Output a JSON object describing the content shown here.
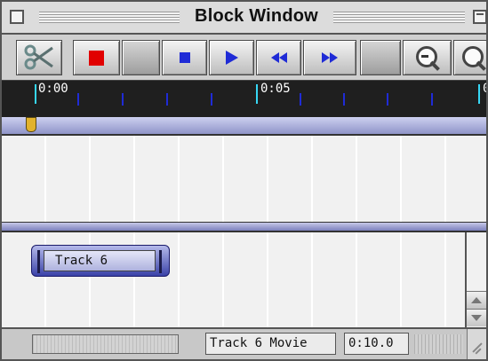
{
  "window": {
    "title": "Block Window"
  },
  "toolbar": {
    "buttons": [
      {
        "name": "cut-button",
        "icon": "scissors-icon"
      },
      {
        "name": "stop-record-button",
        "icon": "red-square-icon"
      },
      {
        "name": "blank-button"
      },
      {
        "name": "stop-button",
        "icon": "stop-icon"
      },
      {
        "name": "play-button",
        "icon": "play-icon"
      },
      {
        "name": "rewind-button",
        "icon": "rewind-icon"
      },
      {
        "name": "fast-forward-button",
        "icon": "fast-forward-icon"
      },
      {
        "name": "blank-button-2"
      },
      {
        "name": "zoom-out-button",
        "icon": "zoom-out-icon"
      },
      {
        "name": "zoom-in-button",
        "icon": "zoom-in-icon"
      }
    ]
  },
  "ruler": {
    "label_start": "0:00",
    "label_mid": "0:05",
    "label_end": "0"
  },
  "timeline": {
    "track_label": "Track 6"
  },
  "status": {
    "track_name": "Track 6 Movie",
    "time": "0:10.0"
  },
  "colors": {
    "accent_blue": "#1f2bd6",
    "record_red": "#e10000",
    "ruler_cyan": "#37d7f4",
    "playhead_gold": "#e2b22c"
  }
}
